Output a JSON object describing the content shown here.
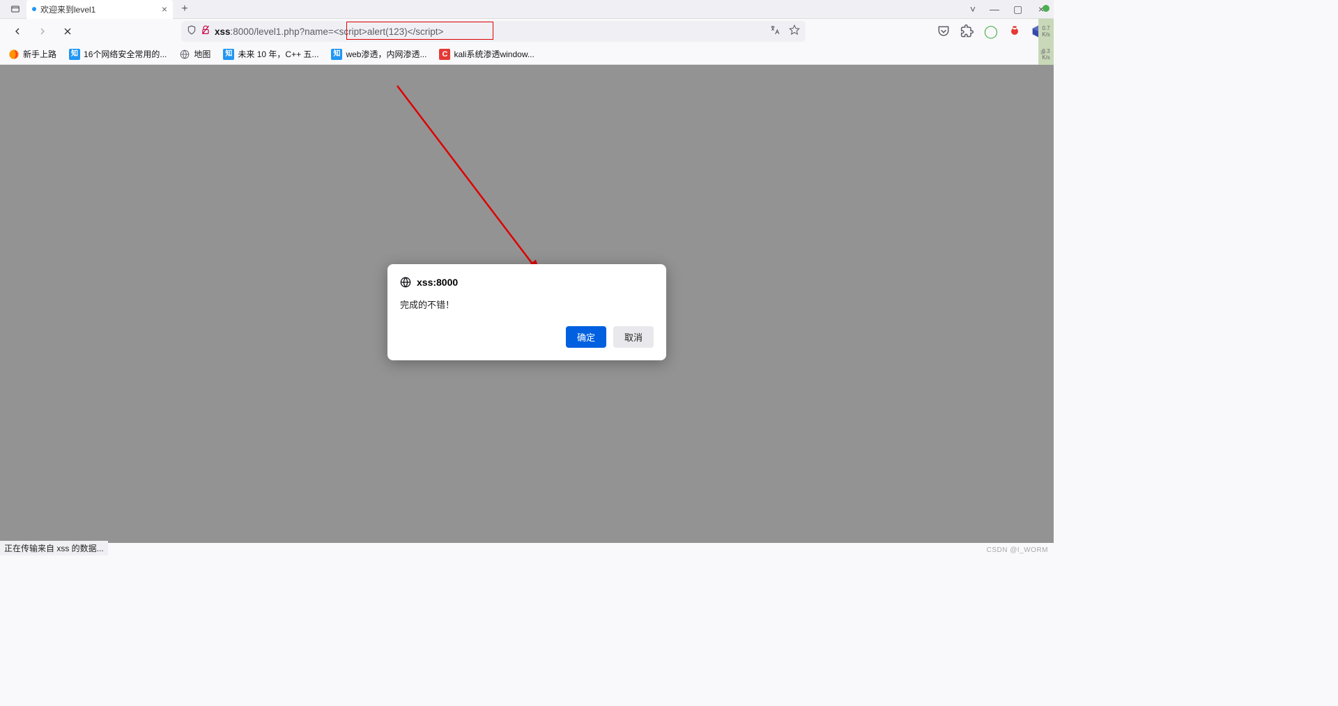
{
  "tab": {
    "title": "欢迎来到level1",
    "new_tab": "+",
    "close": "×"
  },
  "window_controls": {
    "minimize": "—",
    "maximize": "▢",
    "close": "×",
    "chevron": "˅"
  },
  "nav": {
    "back": "back",
    "forward": "forward",
    "stop": "stop"
  },
  "url": {
    "host": "xss",
    "port": ":8000",
    "path": "/level1.php?name=",
    "query_highlight": "<script>alert(123)</script>"
  },
  "url_actions": {
    "translate": "translate-icon",
    "bookmark": "star-icon"
  },
  "toolbar": {
    "pocket": "pocket-icon",
    "extensions": "puzzle-icon",
    "ext1": "green-circle",
    "ext2": "bug-red",
    "ext3": "cube-blue"
  },
  "bookmarks": [
    {
      "icon": "firefox",
      "label": "新手上路"
    },
    {
      "icon": "zhi",
      "label": "16个网络安全常用的..."
    },
    {
      "icon": "globe",
      "label": "地图"
    },
    {
      "icon": "zhi",
      "label": "未来 10 年，C++ 五..."
    },
    {
      "icon": "zhi",
      "label": "web渗透，内网渗透..."
    },
    {
      "icon": "c",
      "label": "kali系统渗透window..."
    }
  ],
  "dialog": {
    "host": "xss:8000",
    "message": "完成的不错！",
    "ok": "确定",
    "cancel": "取消"
  },
  "status": "正在传输来自 xss 的数据...",
  "meters": {
    "top_val": "0.7",
    "top_unit": "K/s",
    "bot_val": "0.3",
    "bot_unit": "K/s"
  },
  "watermark": "CSDN @I_WORM"
}
